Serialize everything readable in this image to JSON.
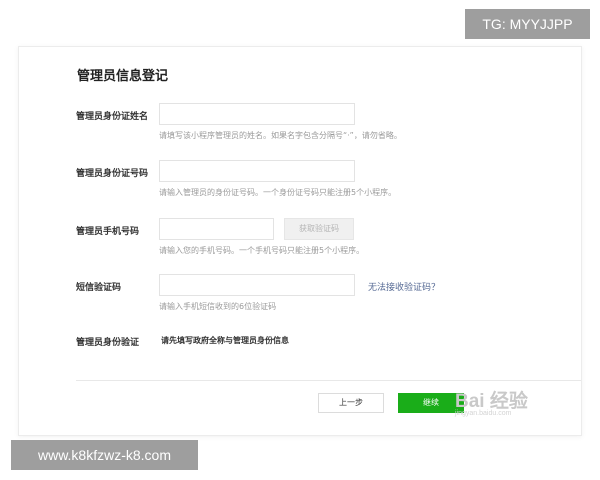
{
  "overlay": {
    "tg_badge": "TG: MYYJJPP",
    "url_badge": "www.k8kfzwz-k8.com"
  },
  "form": {
    "title": "管理员信息登记",
    "fields": [
      {
        "label": "管理员身份证姓名",
        "value": "",
        "hint": "请填写该小程序管理员的姓名。如果名字包含分隔号“·”，请勿省略。"
      },
      {
        "label": "管理员身份证号码",
        "value": "",
        "hint": "请输入管理员的身份证号码。一个身份证号码只能注册5个小程序。"
      },
      {
        "label": "管理员手机号码",
        "value": "",
        "hint": "请输入您的手机号码。一个手机号码只能注册5个小程序。",
        "button": "获取验证码"
      },
      {
        "label": "短信验证码",
        "value": "",
        "hint": "请输入手机短信收到的6位验证码",
        "link": "无法接收验证码？"
      },
      {
        "label": "管理员身份验证",
        "static_text": "请先填写政府全称与管理员身份信息"
      }
    ],
    "prev_button": "上一步",
    "next_button": "继续"
  },
  "watermark": {
    "text": "Bai 经验",
    "sub": "jingyan.baidu.com"
  },
  "colors": {
    "primary_green": "#1aad19",
    "link_blue": "#576b95",
    "hint_gray": "#9a9a9a",
    "badge_gray": "#9e9e9e"
  }
}
